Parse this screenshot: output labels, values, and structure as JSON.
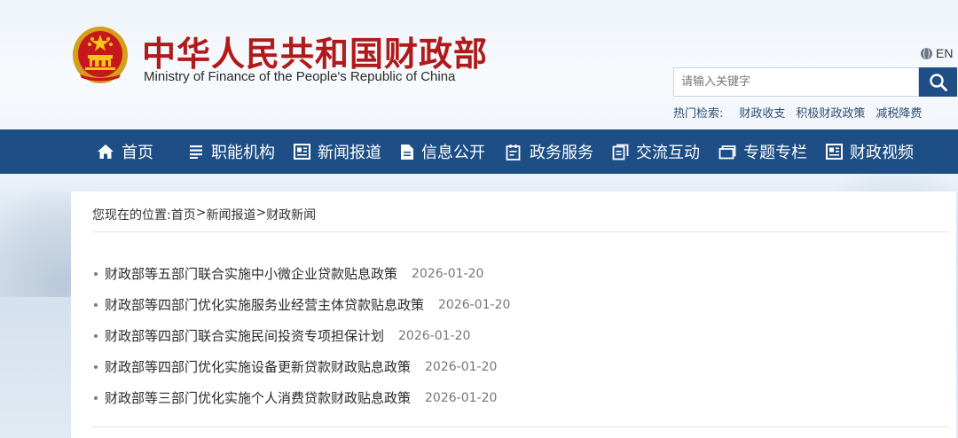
{
  "header": {
    "title": "中华人民共和国财政部",
    "subtitle": "Ministry of Finance of the People's Republic of China",
    "lang_label": "EN",
    "search": {
      "placeholder": "请输入关键字"
    },
    "hot_label": "热门检索:",
    "hot_items": [
      "财政收支",
      "积极财政政策",
      "减税降费"
    ]
  },
  "nav": {
    "items": [
      {
        "label": "首页",
        "icon": "home-icon"
      },
      {
        "label": "职能机构",
        "icon": "list-icon"
      },
      {
        "label": "新闻报道",
        "icon": "news-icon"
      },
      {
        "label": "信息公开",
        "icon": "document-icon"
      },
      {
        "label": "政务服务",
        "icon": "service-icon"
      },
      {
        "label": "交流互动",
        "icon": "interaction-icon"
      },
      {
        "label": "专题专栏",
        "icon": "folder-icon"
      },
      {
        "label": "财政视频",
        "icon": "video-icon"
      }
    ]
  },
  "breadcrumb": {
    "prefix": "您现在的位置:",
    "items": [
      "首页",
      "新闻报道",
      "财政新闻"
    ],
    "separator": ">"
  },
  "news": [
    {
      "title": "财政部等五部门联合实施中小微企业贷款贴息政策",
      "date": "2026-01-20"
    },
    {
      "title": "财政部等四部门优化实施服务业经营主体贷款贴息政策",
      "date": "2026-01-20"
    },
    {
      "title": "财政部等四部门联合实施民间投资专项担保计划",
      "date": "2026-01-20"
    },
    {
      "title": "财政部等四部门优化实施设备更新贷款财政贴息政策",
      "date": "2026-01-20"
    },
    {
      "title": "财政部等三部门优化实施个人消费贷款财政贴息政策",
      "date": "2026-01-20"
    }
  ],
  "colors": {
    "nav_bg": "#1d4e85",
    "title_red": "#b01a1a",
    "search_button": "#1f4f86"
  }
}
